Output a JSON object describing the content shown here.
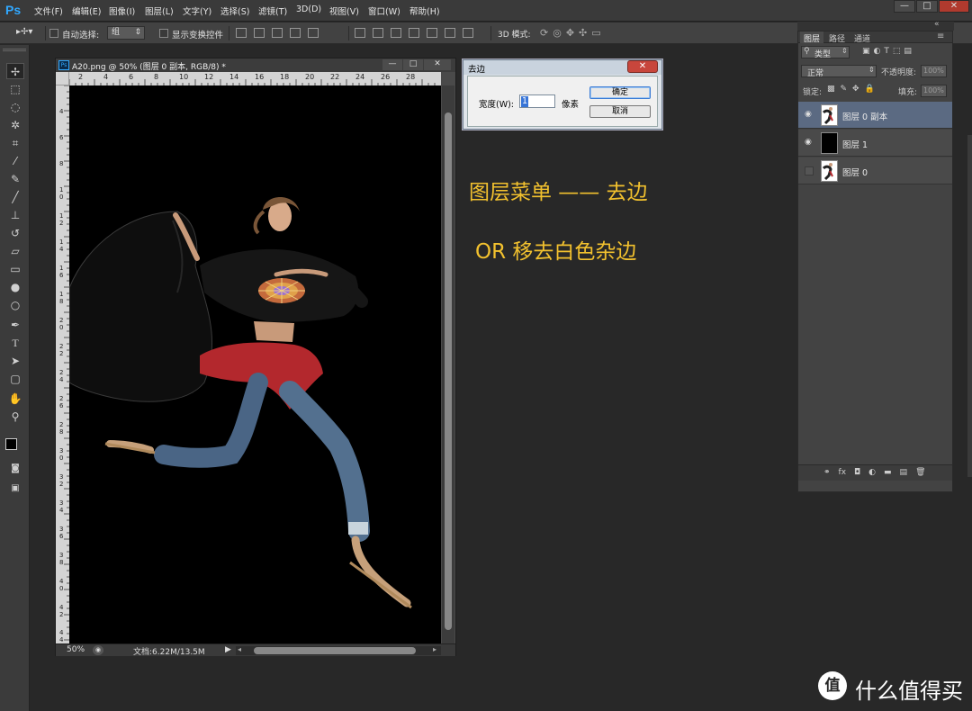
{
  "app": {
    "logo": "Ps",
    "accent": "#31a8ff"
  },
  "menubar": {
    "items": [
      "文件(F)",
      "编辑(E)",
      "图像(I)",
      "图层(L)",
      "文字(Y)",
      "选择(S)",
      "滤镜(T)",
      "3D(D)",
      "视图(V)",
      "窗口(W)",
      "帮助(H)"
    ],
    "window_controls": [
      "—",
      "□",
      "✕"
    ]
  },
  "options_bar": {
    "auto_select_label": "自动选择:",
    "auto_select_value": "组",
    "show_transform_label": "显示变换控件",
    "mode_3d_label": "3D 模式:"
  },
  "toolbar": {
    "tools": [
      "move-tool",
      "marquee-tool",
      "lasso-tool",
      "magic-wand-tool",
      "crop-tool",
      "eyedropper-tool",
      "healing-brush-tool",
      "brush-tool",
      "clone-stamp-tool",
      "history-brush-tool",
      "eraser-tool",
      "gradient-tool",
      "blur-tool",
      "dodge-tool",
      "pen-tool",
      "type-tool",
      "path-selection-tool",
      "shape-tool",
      "hand-tool",
      "zoom-tool"
    ],
    "foreground_color": "#000000",
    "background_color": "#ffffff"
  },
  "document": {
    "title": "A20.png @ 50% (图层 0 副本, RGB/8) *",
    "icon": "Ps",
    "ruler_top": [
      "2",
      "4",
      "6",
      "8",
      "10",
      "12",
      "14",
      "16",
      "18",
      "20",
      "22",
      "24",
      "26",
      "28"
    ],
    "ruler_left": [
      "4",
      "6",
      "8",
      "10",
      "12",
      "14",
      "16",
      "18",
      "20",
      "22",
      "24",
      "26",
      "28",
      "30",
      "32",
      "34",
      "36",
      "38",
      "40",
      "42",
      "44"
    ],
    "zoom": "50%",
    "doc_info": "文档:6.22M/13.5M"
  },
  "dialog": {
    "title": "去边",
    "width_label": "宽度(W):",
    "width_value": "1",
    "unit": "像素",
    "ok_label": "确定",
    "cancel_label": "取消",
    "close_glyph": "✕"
  },
  "annotations": {
    "line1": "图层菜单 —— 去边",
    "line2": "OR 移去白色杂边",
    "color": "#f2c12e"
  },
  "layers_panel": {
    "tabs": [
      "图层",
      "路径",
      "通道"
    ],
    "filter_label": "类型",
    "blend_mode": "正常",
    "opacity_label": "不透明度:",
    "opacity_value": "100%",
    "lock_label": "锁定:",
    "fill_label": "填充:",
    "fill_value": "100%",
    "layers": [
      {
        "name": "图层 0 副本",
        "visible": true,
        "selected": true,
        "thumb": "person"
      },
      {
        "name": "图层 1",
        "visible": true,
        "selected": false,
        "thumb": "black"
      },
      {
        "name": "图层 0",
        "visible": false,
        "selected": false,
        "thumb": "person-white"
      }
    ]
  },
  "watermark": {
    "logo_glyph": "值",
    "text": "什么值得买"
  }
}
